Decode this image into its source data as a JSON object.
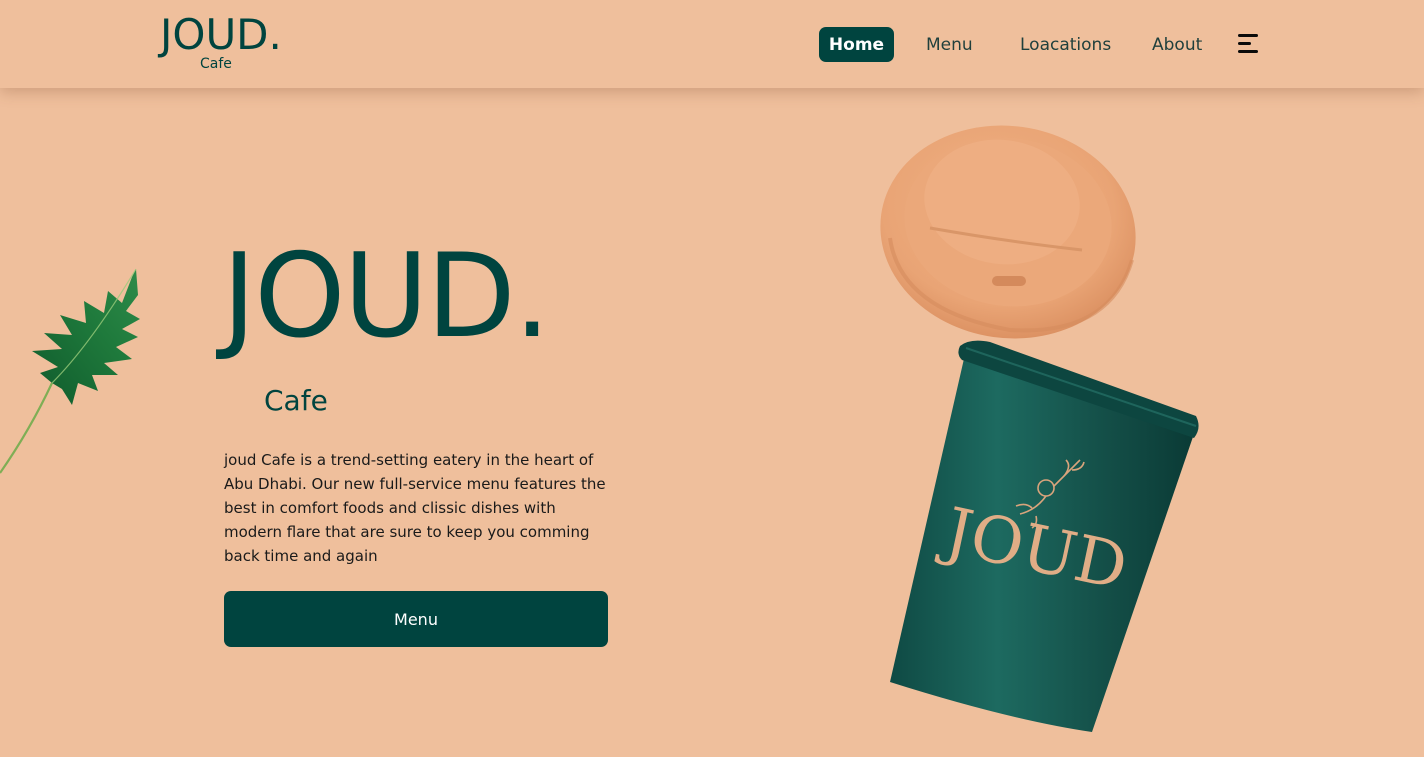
{
  "brand": {
    "logo_main": "JOUD.",
    "logo_sub": "Cafe"
  },
  "nav": {
    "items": [
      {
        "label": "Home",
        "active": true
      },
      {
        "label": "Menu",
        "active": false
      },
      {
        "label": "Loacations",
        "active": false
      },
      {
        "label": "About",
        "active": false
      }
    ],
    "menu_icon": "hamburger-icon"
  },
  "hero": {
    "title": "JOUD.",
    "subtitle": "Cafe",
    "description": "joud Cafe is a trend-setting eatery in the heart of Abu Dhabi. Our new full-service menu features the best in comfort foods and clissic dishes with modern flare that are sure to keep you comming back time and again",
    "button_label": "Menu",
    "cup_brand_text": "JOUD"
  },
  "images": {
    "leaf": "monstera-leaf-icon",
    "cup": "coffee-cup-illustration"
  },
  "colors": {
    "background": "#efbf9c",
    "primary": "#00443f",
    "text": "#1a1a1a",
    "cup_body": "#1a5a52",
    "lid": "#eaa579"
  }
}
